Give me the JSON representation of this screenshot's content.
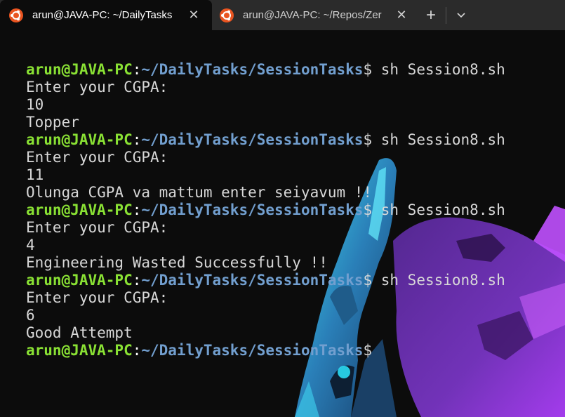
{
  "tabs": [
    {
      "title": "arun@JAVA-PC: ~/DailyTasks",
      "icon": "ubuntu-icon",
      "active": true
    },
    {
      "title": "arun@JAVA-PC: ~/Repos/Zer",
      "icon": "ubuntu-icon",
      "active": false
    }
  ],
  "tabbar": {
    "new_tab": "+",
    "dropdown": "⌄",
    "close": "✕"
  },
  "colors": {
    "user": "#8ae234",
    "path": "#729fcf",
    "text": "#cccccc",
    "bg": "#0c0c0c"
  },
  "prompt": {
    "user_host": "arun@JAVA-PC",
    "sep": ":",
    "path": "~/DailyTasks/SessionTasks",
    "symbol": "$"
  },
  "terminal": {
    "lines": [
      {
        "type": "prompt",
        "cmd": " sh Session8.sh"
      },
      {
        "type": "out",
        "text": "Enter your CGPA:"
      },
      {
        "type": "out",
        "text": "10"
      },
      {
        "type": "out",
        "text": "Topper"
      },
      {
        "type": "prompt",
        "cmd": " sh Session8.sh"
      },
      {
        "type": "out",
        "text": "Enter your CGPA:"
      },
      {
        "type": "out",
        "text": "11"
      },
      {
        "type": "out",
        "text": "Olunga CGPA va mattum enter seiyavum !!"
      },
      {
        "type": "prompt",
        "cmd": " sh Session8.sh"
      },
      {
        "type": "out",
        "text": "Enter your CGPA:"
      },
      {
        "type": "out",
        "text": "4"
      },
      {
        "type": "out",
        "text": "Engineering Wasted Successfully !!"
      },
      {
        "type": "prompt",
        "cmd": " sh Session8.sh"
      },
      {
        "type": "out",
        "text": "Enter your CGPA:"
      },
      {
        "type": "out",
        "text": "6"
      },
      {
        "type": "out",
        "text": "Good Attempt"
      },
      {
        "type": "prompt",
        "cmd": ""
      }
    ]
  }
}
